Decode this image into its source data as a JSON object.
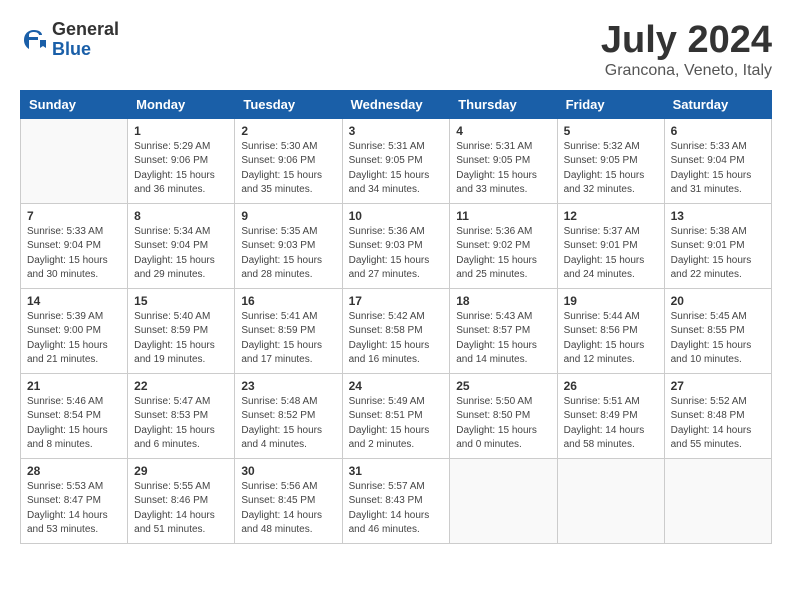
{
  "header": {
    "logo": {
      "general": "General",
      "blue": "Blue"
    },
    "title": "July 2024",
    "location": "Grancona, Veneto, Italy"
  },
  "calendar": {
    "days_of_week": [
      "Sunday",
      "Monday",
      "Tuesday",
      "Wednesday",
      "Thursday",
      "Friday",
      "Saturday"
    ],
    "weeks": [
      [
        {
          "date": "",
          "info": ""
        },
        {
          "date": "1",
          "info": "Sunrise: 5:29 AM\nSunset: 9:06 PM\nDaylight: 15 hours\nand 36 minutes."
        },
        {
          "date": "2",
          "info": "Sunrise: 5:30 AM\nSunset: 9:06 PM\nDaylight: 15 hours\nand 35 minutes."
        },
        {
          "date": "3",
          "info": "Sunrise: 5:31 AM\nSunset: 9:05 PM\nDaylight: 15 hours\nand 34 minutes."
        },
        {
          "date": "4",
          "info": "Sunrise: 5:31 AM\nSunset: 9:05 PM\nDaylight: 15 hours\nand 33 minutes."
        },
        {
          "date": "5",
          "info": "Sunrise: 5:32 AM\nSunset: 9:05 PM\nDaylight: 15 hours\nand 32 minutes."
        },
        {
          "date": "6",
          "info": "Sunrise: 5:33 AM\nSunset: 9:04 PM\nDaylight: 15 hours\nand 31 minutes."
        }
      ],
      [
        {
          "date": "7",
          "info": "Sunrise: 5:33 AM\nSunset: 9:04 PM\nDaylight: 15 hours\nand 30 minutes."
        },
        {
          "date": "8",
          "info": "Sunrise: 5:34 AM\nSunset: 9:04 PM\nDaylight: 15 hours\nand 29 minutes."
        },
        {
          "date": "9",
          "info": "Sunrise: 5:35 AM\nSunset: 9:03 PM\nDaylight: 15 hours\nand 28 minutes."
        },
        {
          "date": "10",
          "info": "Sunrise: 5:36 AM\nSunset: 9:03 PM\nDaylight: 15 hours\nand 27 minutes."
        },
        {
          "date": "11",
          "info": "Sunrise: 5:36 AM\nSunset: 9:02 PM\nDaylight: 15 hours\nand 25 minutes."
        },
        {
          "date": "12",
          "info": "Sunrise: 5:37 AM\nSunset: 9:01 PM\nDaylight: 15 hours\nand 24 minutes."
        },
        {
          "date": "13",
          "info": "Sunrise: 5:38 AM\nSunset: 9:01 PM\nDaylight: 15 hours\nand 22 minutes."
        }
      ],
      [
        {
          "date": "14",
          "info": "Sunrise: 5:39 AM\nSunset: 9:00 PM\nDaylight: 15 hours\nand 21 minutes."
        },
        {
          "date": "15",
          "info": "Sunrise: 5:40 AM\nSunset: 8:59 PM\nDaylight: 15 hours\nand 19 minutes."
        },
        {
          "date": "16",
          "info": "Sunrise: 5:41 AM\nSunset: 8:59 PM\nDaylight: 15 hours\nand 17 minutes."
        },
        {
          "date": "17",
          "info": "Sunrise: 5:42 AM\nSunset: 8:58 PM\nDaylight: 15 hours\nand 16 minutes."
        },
        {
          "date": "18",
          "info": "Sunrise: 5:43 AM\nSunset: 8:57 PM\nDaylight: 15 hours\nand 14 minutes."
        },
        {
          "date": "19",
          "info": "Sunrise: 5:44 AM\nSunset: 8:56 PM\nDaylight: 15 hours\nand 12 minutes."
        },
        {
          "date": "20",
          "info": "Sunrise: 5:45 AM\nSunset: 8:55 PM\nDaylight: 15 hours\nand 10 minutes."
        }
      ],
      [
        {
          "date": "21",
          "info": "Sunrise: 5:46 AM\nSunset: 8:54 PM\nDaylight: 15 hours\nand 8 minutes."
        },
        {
          "date": "22",
          "info": "Sunrise: 5:47 AM\nSunset: 8:53 PM\nDaylight: 15 hours\nand 6 minutes."
        },
        {
          "date": "23",
          "info": "Sunrise: 5:48 AM\nSunset: 8:52 PM\nDaylight: 15 hours\nand 4 minutes."
        },
        {
          "date": "24",
          "info": "Sunrise: 5:49 AM\nSunset: 8:51 PM\nDaylight: 15 hours\nand 2 minutes."
        },
        {
          "date": "25",
          "info": "Sunrise: 5:50 AM\nSunset: 8:50 PM\nDaylight: 15 hours\nand 0 minutes."
        },
        {
          "date": "26",
          "info": "Sunrise: 5:51 AM\nSunset: 8:49 PM\nDaylight: 14 hours\nand 58 minutes."
        },
        {
          "date": "27",
          "info": "Sunrise: 5:52 AM\nSunset: 8:48 PM\nDaylight: 14 hours\nand 55 minutes."
        }
      ],
      [
        {
          "date": "28",
          "info": "Sunrise: 5:53 AM\nSunset: 8:47 PM\nDaylight: 14 hours\nand 53 minutes."
        },
        {
          "date": "29",
          "info": "Sunrise: 5:55 AM\nSunset: 8:46 PM\nDaylight: 14 hours\nand 51 minutes."
        },
        {
          "date": "30",
          "info": "Sunrise: 5:56 AM\nSunset: 8:45 PM\nDaylight: 14 hours\nand 48 minutes."
        },
        {
          "date": "31",
          "info": "Sunrise: 5:57 AM\nSunset: 8:43 PM\nDaylight: 14 hours\nand 46 minutes."
        },
        {
          "date": "",
          "info": ""
        },
        {
          "date": "",
          "info": ""
        },
        {
          "date": "",
          "info": ""
        }
      ]
    ]
  }
}
